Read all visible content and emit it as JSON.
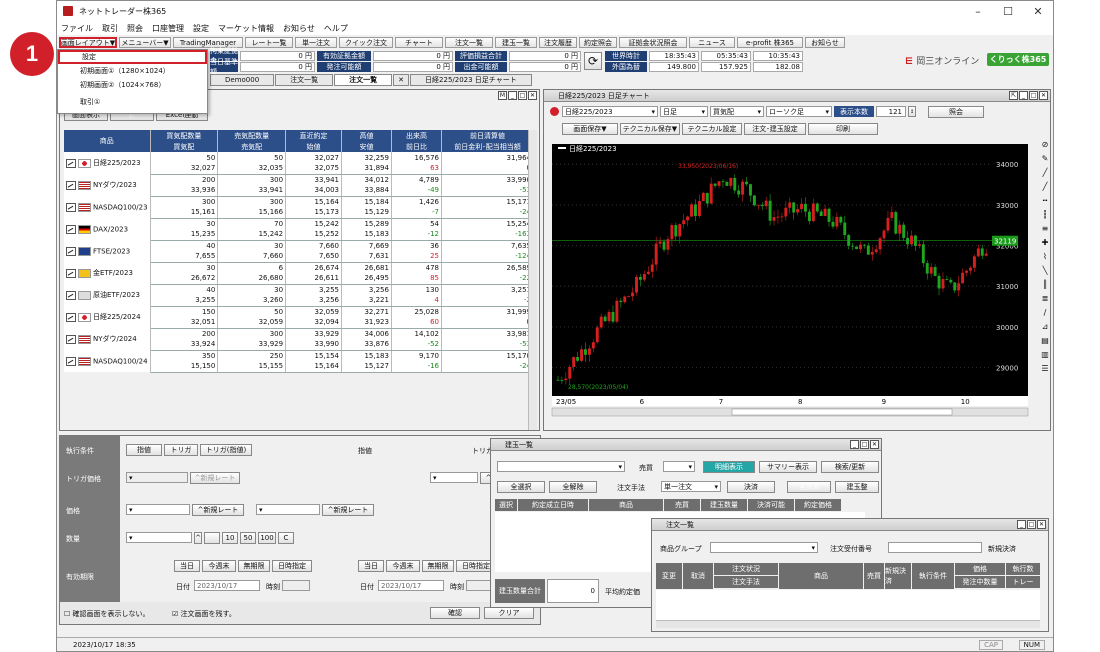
{
  "window": {
    "title": "ネットトレーダー株365"
  },
  "menu": [
    "ファイル",
    "取引",
    "照会",
    "口座管理",
    "設定",
    "マーケット情報",
    "お知らせ",
    "ヘルプ"
  ],
  "toolbar": [
    "画面レイアウト▼",
    "メニューバー▼",
    "TradingManager",
    "レート一覧",
    "単一注文",
    "クイック注文",
    "チャート",
    "注文一覧",
    "建玉一覧",
    "注文履歴",
    "約定照会",
    "証拠金状況照会",
    "ニュース",
    "e-profit 株365",
    "お知らせ"
  ],
  "dropdown": {
    "items": [
      "設定",
      "初期画面①（1280×1024）",
      "初期画面②（1024×768）",
      "取引①"
    ]
  },
  "callout": "1",
  "info": {
    "labels": [
      "有効証拠金額",
      "発注可能額",
      "評価損益合計",
      "出金可能額",
      "世界時計",
      "外国為替"
    ],
    "values": [
      "0 円",
      "0 円",
      "0 円",
      "0 円"
    ],
    "values2": [
      "0 円",
      "0 円"
    ],
    "left_labels": [
      "拘束証拠金",
      "当日基準額"
    ],
    "clock": [
      "18:35:43",
      "05:35:43",
      "10:35:43"
    ],
    "fx": [
      "149.800",
      "157.925",
      "182.08"
    ]
  },
  "brand": {
    "company": "岡三オンライン",
    "product": "くりっく株365"
  },
  "tabs": [
    "Demo000",
    "注文一覧",
    "注文一覧",
    "日経225/2023 日足チャート"
  ],
  "quote": {
    "buttons": [
      "画面表示",
      "新",
      "Excel連動"
    ],
    "headers1": [
      "商品",
      "買気配数量",
      "売気配数量",
      "直近約定",
      "高値",
      "出来高",
      "前日清算値"
    ],
    "headers2": [
      "",
      "買気配",
      "売気配",
      "始値",
      "安値",
      "前日比",
      "前日金利･配当相当額"
    ],
    "rows": [
      {
        "name": "日経225/2023",
        "r1": [
          "50",
          "50",
          "32,027",
          "32,259",
          "16,576",
          "31,964"
        ],
        "r2": [
          "32,027",
          "32,035",
          "32,075",
          "31,894",
          "63",
          "0"
        ]
      },
      {
        "name": "NYダウ/2023",
        "r1": [
          "200",
          "300",
          "33,941",
          "34,012",
          "4,789",
          "33,990"
        ],
        "r2": [
          "33,936",
          "33,941",
          "34,003",
          "33,884",
          "-49",
          "-53"
        ]
      },
      {
        "name": "NASDAQ100/23",
        "r1": [
          "300",
          "300",
          "15,164",
          "15,184",
          "1,426",
          "15,171"
        ],
        "r2": [
          "15,161",
          "15,166",
          "15,173",
          "15,129",
          "-7",
          "-24"
        ]
      },
      {
        "name": "DAX/2023",
        "r1": [
          "30",
          "70",
          "15,242",
          "15,289",
          "54",
          "15,254"
        ],
        "r2": [
          "15,235",
          "15,242",
          "15,252",
          "15,183",
          "-12",
          "-163"
        ]
      },
      {
        "name": "FTSE/2023",
        "r1": [
          "40",
          "30",
          "7,660",
          "7,669",
          "36",
          "7,635"
        ],
        "r2": [
          "7,655",
          "7,660",
          "7,650",
          "7,631",
          "25",
          "-124"
        ]
      },
      {
        "name": "金ETF/2023",
        "r1": [
          "30",
          "6",
          "26,674",
          "26,681",
          "478",
          "26,589"
        ],
        "r2": [
          "26,672",
          "26,680",
          "26,611",
          "26,495",
          "85",
          "-22"
        ]
      },
      {
        "name": "原油ETF/2023",
        "r1": [
          "40",
          "30",
          "3,255",
          "3,256",
          "130",
          "3,251"
        ],
        "r2": [
          "3,255",
          "3,260",
          "3,256",
          "3,221",
          "4",
          "-2"
        ]
      },
      {
        "name": "日経225/2024",
        "r1": [
          "150",
          "50",
          "32,059",
          "32,271",
          "25,028",
          "31,999"
        ],
        "r2": [
          "32,051",
          "32,059",
          "32,094",
          "31,923",
          "60",
          "0"
        ]
      },
      {
        "name": "NYダウ/2024",
        "r1": [
          "200",
          "300",
          "33,929",
          "34,006",
          "14,102",
          "33,981"
        ],
        "r2": [
          "33,924",
          "33,929",
          "33,990",
          "33,876",
          "-52",
          "-53"
        ]
      },
      {
        "name": "NASDAQ100/24",
        "r1": [
          "350",
          "250",
          "15,154",
          "15,183",
          "9,170",
          "15,170"
        ],
        "r2": [
          "15,150",
          "15,155",
          "15,164",
          "15,127",
          "-16",
          "-24"
        ]
      }
    ]
  },
  "chart": {
    "title": "日経225/2023 日足チャート",
    "symbol": "日経225/2023",
    "period": "日足",
    "side": "買気配",
    "ctype": "ローソク足",
    "count_label": "表示本数",
    "count": "121",
    "buttons": [
      "照会",
      "画面保存▼",
      "テクニカル保存▼",
      "テクニカル設定",
      "注文･建玉設定",
      "印刷"
    ],
    "legend": "日経225/2023",
    "high_note": "33,950(2023/06/16)",
    "low_note": "28,570(2023/05/04)",
    "yticks": [
      "34000",
      "33000",
      "32000",
      "31000",
      "30000",
      "29000"
    ],
    "current": "32119",
    "xticks": [
      "23/05",
      "6",
      "7",
      "8",
      "9",
      "10"
    ]
  },
  "order": {
    "labels": [
      "執行条件",
      "トリガ価格",
      "価格",
      "数量",
      "有効期限"
    ],
    "cond_buttons": [
      "指値",
      "トリガ",
      "トリガ(指値)"
    ],
    "col_heads": [
      "指値",
      "トリガ"
    ],
    "rate_btn": "新規レート",
    "qty_btns": [
      "10",
      "50",
      "100",
      "C"
    ],
    "exp_btns": [
      "当日",
      "今週末",
      "無期限",
      "日時指定"
    ],
    "date_label": "日付",
    "date": "2023/10/17",
    "time_label": "時刻",
    "check1": "確認画面を表示しない。",
    "check2": "注文画面を残す。",
    "confirm": "確認",
    "clear": "クリア"
  },
  "position": {
    "title": "建玉一覧",
    "side_label": "売買",
    "buttons": [
      "明細表示",
      "サマリー表示",
      "検索/更新"
    ],
    "buttons2": [
      "全選択",
      "全解除"
    ],
    "method_label": "注文手法",
    "method": "単一注文",
    "settle": "決済",
    "all_settle": "全決済",
    "settle2": "建玉整",
    "headers": [
      "選択",
      "約定成立日時",
      "商品",
      "売買",
      "建玉数量",
      "決済可能",
      "約定価格"
    ],
    "total_label": "建玉数量合計",
    "total": "0",
    "avg_label": "平均約定価"
  },
  "orders": {
    "title": "注文一覧",
    "group_label": "商品グループ",
    "receipt_label": "注文受付番号",
    "new_settle": "新規決済",
    "headers": [
      "変更",
      "取消",
      "注文状況",
      "注文手法",
      "商品",
      "売買",
      "新規決済",
      "執行条件",
      "価格",
      "発注中数量",
      "執行数",
      "トレー"
    ]
  },
  "status": {
    "date": "2023/10/17 18:35",
    "cap": "CAP",
    "num": "NUM"
  }
}
